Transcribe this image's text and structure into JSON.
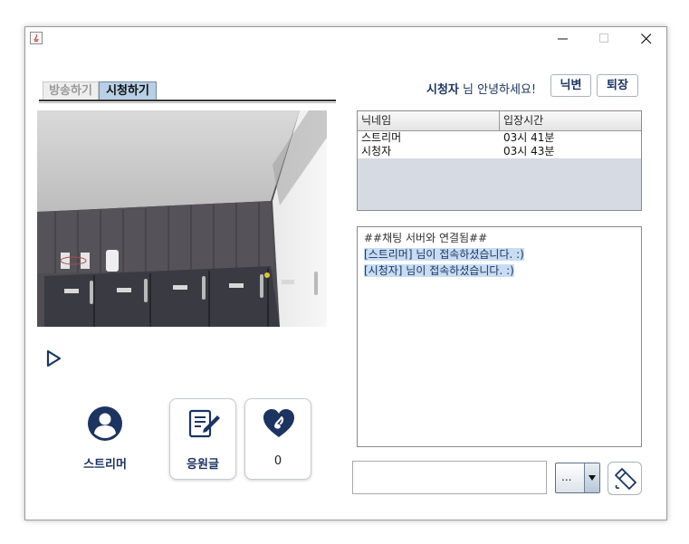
{
  "window": {
    "title": ""
  },
  "tabs": [
    {
      "label": "방송하기",
      "active": false
    },
    {
      "label": "시청하기",
      "active": true
    }
  ],
  "header": {
    "user_name": "시청자",
    "greeting_suffix": "님 안녕하세요!",
    "nick_button": "닉변",
    "exit_button": "퇴장"
  },
  "user_table": {
    "columns": [
      "닉네임",
      "입장시간"
    ],
    "rows": [
      {
        "nickname": "스트리머",
        "time": "03시 41분"
      },
      {
        "nickname": "시청자",
        "time": "03시 43분"
      }
    ]
  },
  "chat": {
    "lines": [
      {
        "text": "##채팅 서버와 연결됨##",
        "highlight": false
      },
      {
        "text": "[스트리머] 님이 접속하셨습니다. :)",
        "highlight": true
      },
      {
        "text": "[시청자] 님이 접속하셨습니다. :)",
        "highlight": true
      }
    ]
  },
  "streamer": {
    "label": "스트리머"
  },
  "cheer": {
    "label": "응원글"
  },
  "like": {
    "count": "0"
  },
  "composer": {
    "message": "",
    "emoji_selected": "..."
  },
  "colors": {
    "accent": "#1d3461",
    "tab_active": "#b8cfe5",
    "selection": "#c8ddf2"
  }
}
